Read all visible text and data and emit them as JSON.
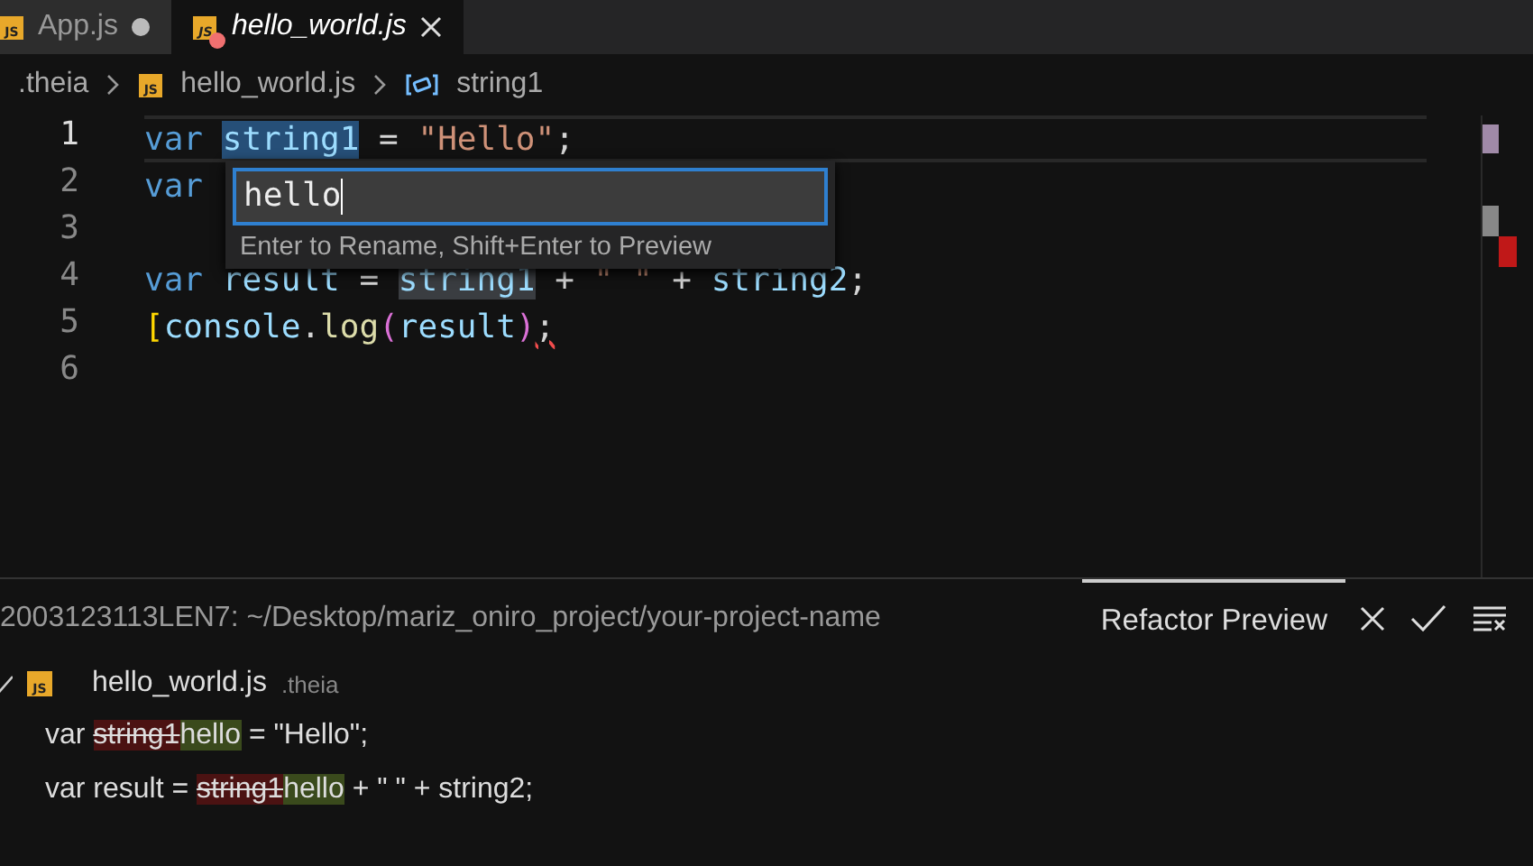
{
  "tabs": [
    {
      "label": "App.js",
      "icon_text": "JS",
      "selected": false,
      "dirty": true,
      "error": false
    },
    {
      "label": "hello_world.js",
      "icon_text": "JS",
      "selected": true,
      "dirty": false,
      "error": true
    }
  ],
  "breadcrumbs": [
    {
      "label": ".theia",
      "kind": "folder"
    },
    {
      "label": "hello_world.js",
      "kind": "file",
      "icon_text": "JS"
    },
    {
      "label": "string1",
      "kind": "symbol"
    }
  ],
  "editor": {
    "lines": [
      {
        "number": "1",
        "current": true,
        "tokens": [
          {
            "text": "var ",
            "kind": "keyword"
          },
          {
            "text": "string1",
            "kind": "ident",
            "selected": true
          },
          {
            "text": " = ",
            "kind": "plain"
          },
          {
            "text": "\"Hello\"",
            "kind": "string"
          },
          {
            "text": ";",
            "kind": "plain"
          }
        ]
      },
      {
        "number": "2",
        "current": false,
        "tokens": [
          {
            "text": "var",
            "kind": "keyword"
          }
        ]
      },
      {
        "number": "3",
        "current": false
      },
      {
        "number": "4",
        "current": false,
        "tokens": [
          {
            "text": "var ",
            "kind": "keyword"
          },
          {
            "text": "result",
            "kind": "ident"
          },
          {
            "text": " = ",
            "kind": "plain"
          },
          {
            "text": "string1",
            "kind": "ident",
            "occurrence": true
          },
          {
            "text": " + ",
            "kind": "plain"
          },
          {
            "text": "\" \"",
            "kind": "string"
          },
          {
            "text": " + ",
            "kind": "plain"
          },
          {
            "text": "string2",
            "kind": "ident"
          },
          {
            "text": ";",
            "kind": "plain"
          }
        ]
      },
      {
        "number": "5",
        "current": false,
        "tokens": [
          {
            "text": "[",
            "kind": "bracket"
          },
          {
            "text": "console",
            "kind": "ident"
          },
          {
            "text": ".",
            "kind": "plain"
          },
          {
            "text": "log",
            "kind": "func"
          },
          {
            "text": "(",
            "kind": "paren"
          },
          {
            "text": "result",
            "kind": "ident"
          },
          {
            "text": ")",
            "kind": "paren"
          },
          {
            "text": ";",
            "kind": "error"
          }
        ]
      },
      {
        "number": "6",
        "current": false
      }
    ],
    "rename": {
      "value": "hello",
      "hint": "Enter to Rename, Shift+Enter to Preview"
    }
  },
  "panel": {
    "terminal_title": "2003123113LEN7: ~/Desktop/mariz_oniro_project/your-project-name",
    "tab": {
      "label": "Refactor Preview",
      "selected": true
    },
    "file": {
      "name": "hello_world.js",
      "folder": ".theia",
      "icon_text": "JS",
      "checked": true
    },
    "changes": [
      [
        {
          "text": "var ",
          "kind": "plain"
        },
        {
          "text": "string1",
          "kind": "deleted"
        },
        {
          "text": "hello",
          "kind": "inserted"
        },
        {
          "text": " = \"Hello\";",
          "kind": "plain"
        }
      ],
      [
        {
          "text": "var result = ",
          "kind": "plain"
        },
        {
          "text": "string1",
          "kind": "deleted"
        },
        {
          "text": "hello",
          "kind": "inserted"
        },
        {
          "text": " + \" \" + string2;",
          "kind": "plain"
        }
      ]
    ]
  }
}
